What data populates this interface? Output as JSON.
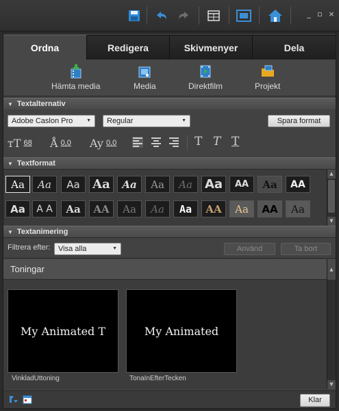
{
  "toolbar": {
    "icons": [
      "save-icon",
      "undo-icon",
      "redo-icon",
      "grid-view-icon",
      "fit-window-icon",
      "home-icon"
    ],
    "window_minimize": "_",
    "window_maximize": "▫",
    "window_close": "×",
    "accent": "#3b8fd9"
  },
  "tabs": [
    {
      "label": "Ordna",
      "active": true
    },
    {
      "label": "Redigera",
      "active": false
    },
    {
      "label": "Skivmenyer",
      "active": false
    },
    {
      "label": "Dela",
      "active": false
    }
  ],
  "actions": [
    {
      "label": "Hämta media",
      "icon": "get-media-icon"
    },
    {
      "label": "Media",
      "icon": "media-icon"
    },
    {
      "label": "Direktfilm",
      "icon": "instant-movie-icon"
    },
    {
      "label": "Projekt",
      "icon": "project-folder-icon"
    }
  ],
  "text_options": {
    "title": "Textalternativ",
    "font": "Adobe Caslon Pro",
    "style": "Regular",
    "save_label": "Spara format",
    "font_size": "68",
    "leading": "0,0",
    "kerning": "0,0"
  },
  "text_format": {
    "title": "Textformat",
    "cell_text": [
      "Aa",
      "Aa",
      "Aa",
      "Aa",
      "Aa",
      "Aa",
      "Aa",
      "Aa",
      "AA",
      "Aa",
      "AA",
      "Aa",
      "A A",
      "Aa",
      "AA",
      "Aa",
      "Aa",
      "Aa",
      "AA",
      "Aa",
      "AA",
      "Aa"
    ]
  },
  "text_animation": {
    "title": "Textanimering",
    "filter_label": "Filtrera efter:",
    "filter_value": "Visa alla",
    "apply_label": "Använd",
    "remove_label": "Ta bort"
  },
  "gallery": {
    "heading": "Toningar",
    "items": [
      {
        "preview": "My Animated T",
        "name": "VinkladUttoning"
      },
      {
        "preview": "My Animated",
        "name": "TonaInEfterTecken"
      }
    ]
  },
  "footer": {
    "done_label": "Klar"
  }
}
